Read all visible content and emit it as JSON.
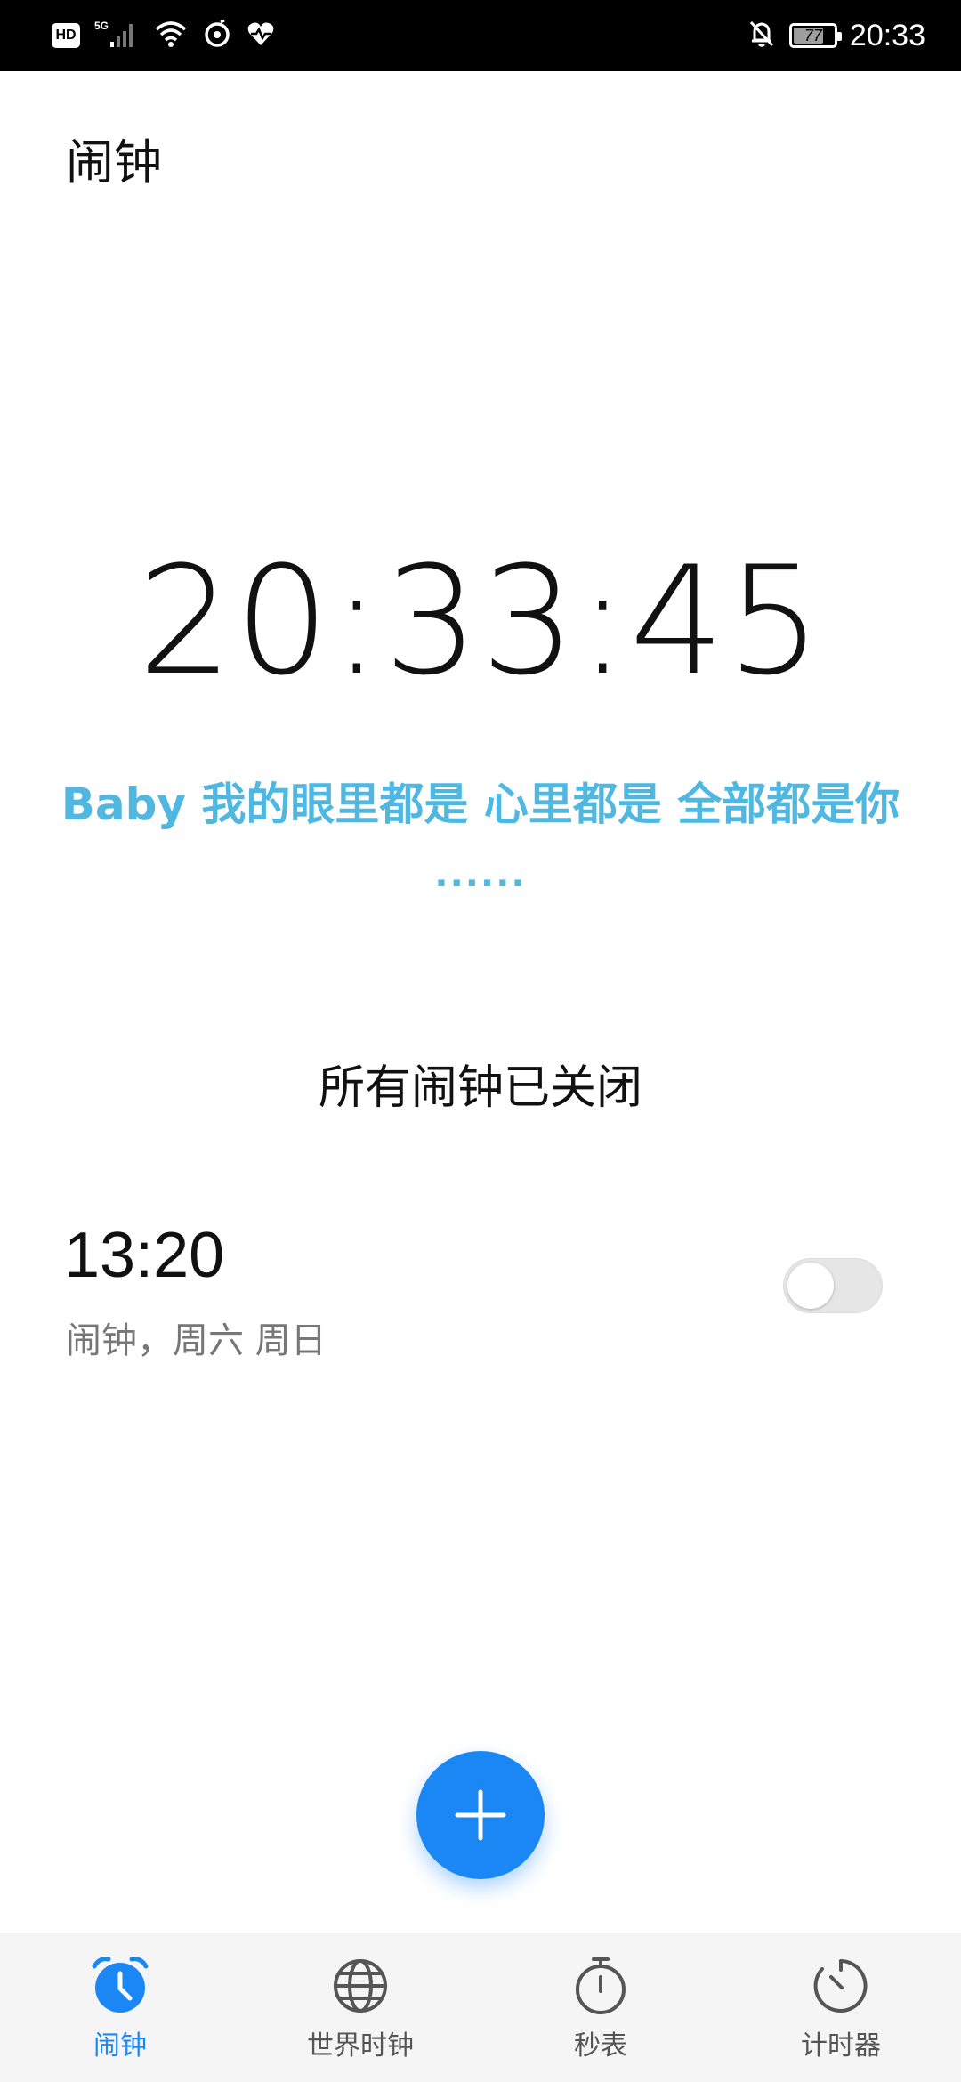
{
  "status_bar": {
    "hd": "HD",
    "network": "5G",
    "battery_level": 77,
    "battery_text": "77",
    "time": "20:33"
  },
  "header": {
    "title": "闹钟"
  },
  "clock": {
    "time": "20:33:45"
  },
  "lyric": {
    "line": "Baby 我的眼里都是 心里都是 全部都是你",
    "dots": "......"
  },
  "alarms_status": "所有闹钟已关闭",
  "alarms": [
    {
      "time": "13:20",
      "subtitle": "闹钟，周六 周日",
      "enabled": false
    }
  ],
  "bottom_nav": {
    "items": [
      {
        "label": "闹钟",
        "icon": "alarm-clock-icon",
        "active": true
      },
      {
        "label": "世界时钟",
        "icon": "globe-icon",
        "active": false
      },
      {
        "label": "秒表",
        "icon": "stopwatch-icon",
        "active": false
      },
      {
        "label": "计时器",
        "icon": "timer-icon",
        "active": false
      }
    ]
  },
  "colors": {
    "accent": "#1a87f5",
    "lyric": "#4fb7e0",
    "status_bar_bg": "#000000"
  }
}
